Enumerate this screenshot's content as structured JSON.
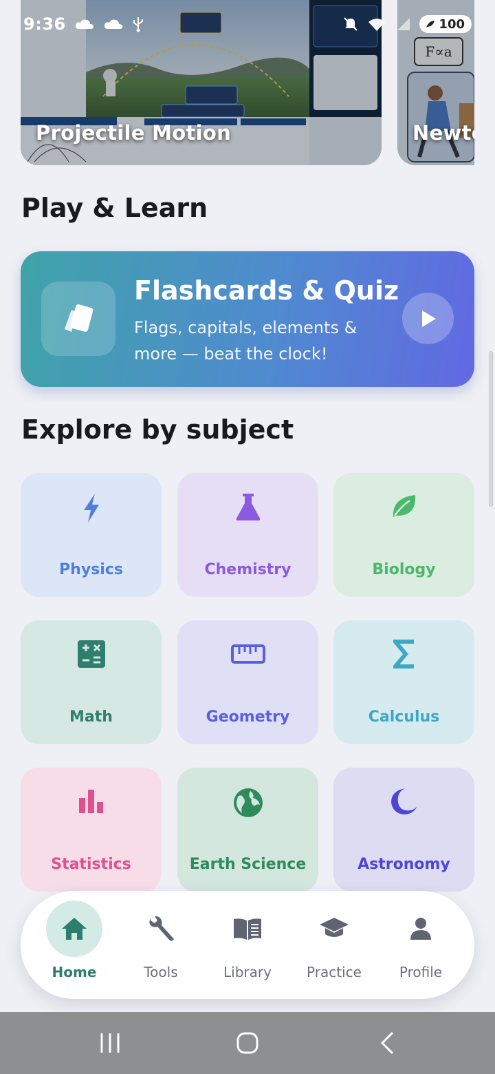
{
  "status_bar": {
    "time": "9:36",
    "battery": "100"
  },
  "carousel": {
    "cards": [
      {
        "title": "Projectile Motion",
        "icon": "projectile-diagram-image"
      },
      {
        "title": "Newto",
        "icon": "newtons-laws-image"
      }
    ]
  },
  "play_section": {
    "title": "Play & Learn",
    "promo": {
      "title": "Flashcards & Quiz",
      "subtitle": "Flags, capitals, elements & more — beat the clock!",
      "icon": "cards-icon",
      "action_icon": "play-icon"
    }
  },
  "subjects_section": {
    "title": "Explore by subject",
    "items": [
      {
        "label": "Physics",
        "icon": "bolt-icon",
        "color": "#4e7fe0",
        "bg": "#dde6f7"
      },
      {
        "label": "Chemistry",
        "icon": "flask-icon",
        "color": "#8a5ae0",
        "bg": "#e6def5"
      },
      {
        "label": "Biology",
        "icon": "leaf-icon",
        "color": "#4bb86b",
        "bg": "#dbece1"
      },
      {
        "label": "Math",
        "icon": "calculator-icon",
        "color": "#2f7f6c",
        "bg": "#d6e8e3"
      },
      {
        "label": "Geometry",
        "icon": "ruler-icon",
        "color": "#5a5ee0",
        "bg": "#dfe0f5"
      },
      {
        "label": "Calculus",
        "icon": "sigma-icon",
        "color": "#3ea7c4",
        "bg": "#d6ebf0"
      },
      {
        "label": "Statistics",
        "icon": "bar-chart-icon",
        "color": "#e0508f",
        "bg": "#f6dde7"
      },
      {
        "label": "Earth Science",
        "icon": "globe-icon",
        "color": "#2f8a5c",
        "bg": "#d4e7df"
      },
      {
        "label": "Astronomy",
        "icon": "moon-icon",
        "color": "#4d45d8",
        "bg": "#dedcf2"
      }
    ]
  },
  "bottom_nav": {
    "items": [
      {
        "label": "Home",
        "icon": "home-icon",
        "active": true
      },
      {
        "label": "Tools",
        "icon": "wrench-icon",
        "active": false
      },
      {
        "label": "Library",
        "icon": "book-icon",
        "active": false
      },
      {
        "label": "Practice",
        "icon": "graduation-cap-icon",
        "active": false
      },
      {
        "label": "Profile",
        "icon": "person-icon",
        "active": false
      }
    ]
  },
  "system_nav": {
    "icons": [
      "recents-icon",
      "home-button-icon",
      "back-icon"
    ]
  }
}
